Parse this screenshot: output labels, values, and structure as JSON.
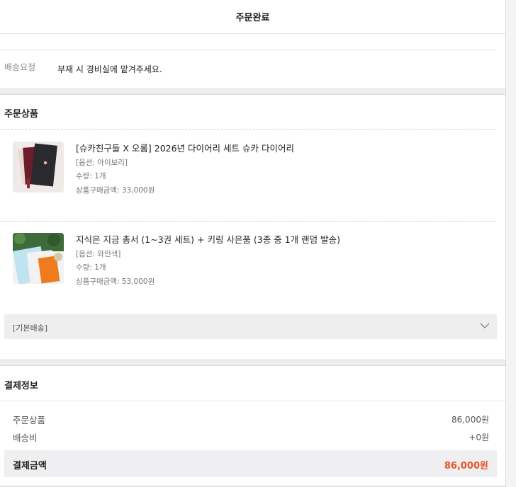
{
  "header": {
    "title": "주문완료"
  },
  "delivery_request": {
    "label": "배송요청",
    "value": "부재 시 경비실에 맡겨주세요."
  },
  "order_items": {
    "title": "주문상품",
    "items": [
      {
        "name": "[슈카친구들 X 오롬] 2026년 다이어리 세트 슈카 다이어리",
        "option": "[옵션: 아이보리]",
        "quantity": "수량: 1개",
        "price": "상품구매금액: 33,000원"
      },
      {
        "name": "지식은 지금 총서 (1~3권 세트) + 키링 사은품 (3종 중 1개 랜덤 발송)",
        "option": "[옵션: 와인색]",
        "quantity": "수량: 1개",
        "price": "상품구매금액: 53,000원"
      }
    ],
    "shipping_group": "[기본배송]"
  },
  "payment": {
    "title": "결제정보",
    "rows": [
      {
        "label": "주문상품",
        "value": "86,000원"
      },
      {
        "label": "배송비",
        "value": "+0원"
      }
    ],
    "total_label": "결제금액",
    "total_value": "86,000원"
  },
  "colors": {
    "accent": "#e8542a",
    "section_gap": "#eeeeee"
  }
}
